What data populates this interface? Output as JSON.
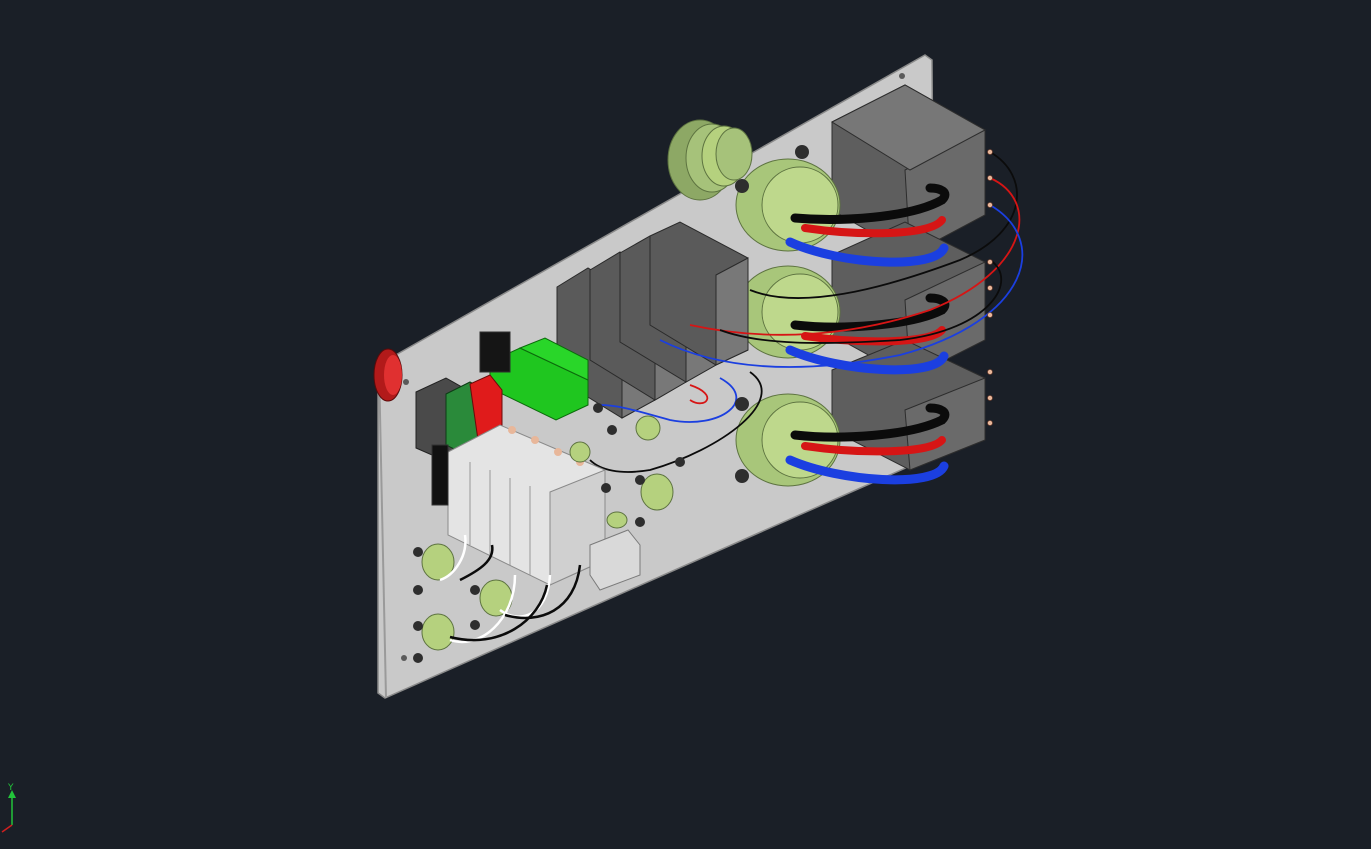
{
  "viewport": {
    "background": "#1a1f27",
    "panel_color": "#c9c9c9",
    "component_gray": "#606060",
    "toroid_green": "#b5d17e",
    "terminal_green": "#1fc61f",
    "terminal_red": "#e01b1b",
    "wire_black": "#0b0b0b",
    "wire_red": "#d61515",
    "wire_blue": "#1b3fe0",
    "wire_white": "#ffffff"
  },
  "ucs": {
    "y_label": "Y",
    "y_color": "#22c43a",
    "x_color": "#d02020"
  }
}
